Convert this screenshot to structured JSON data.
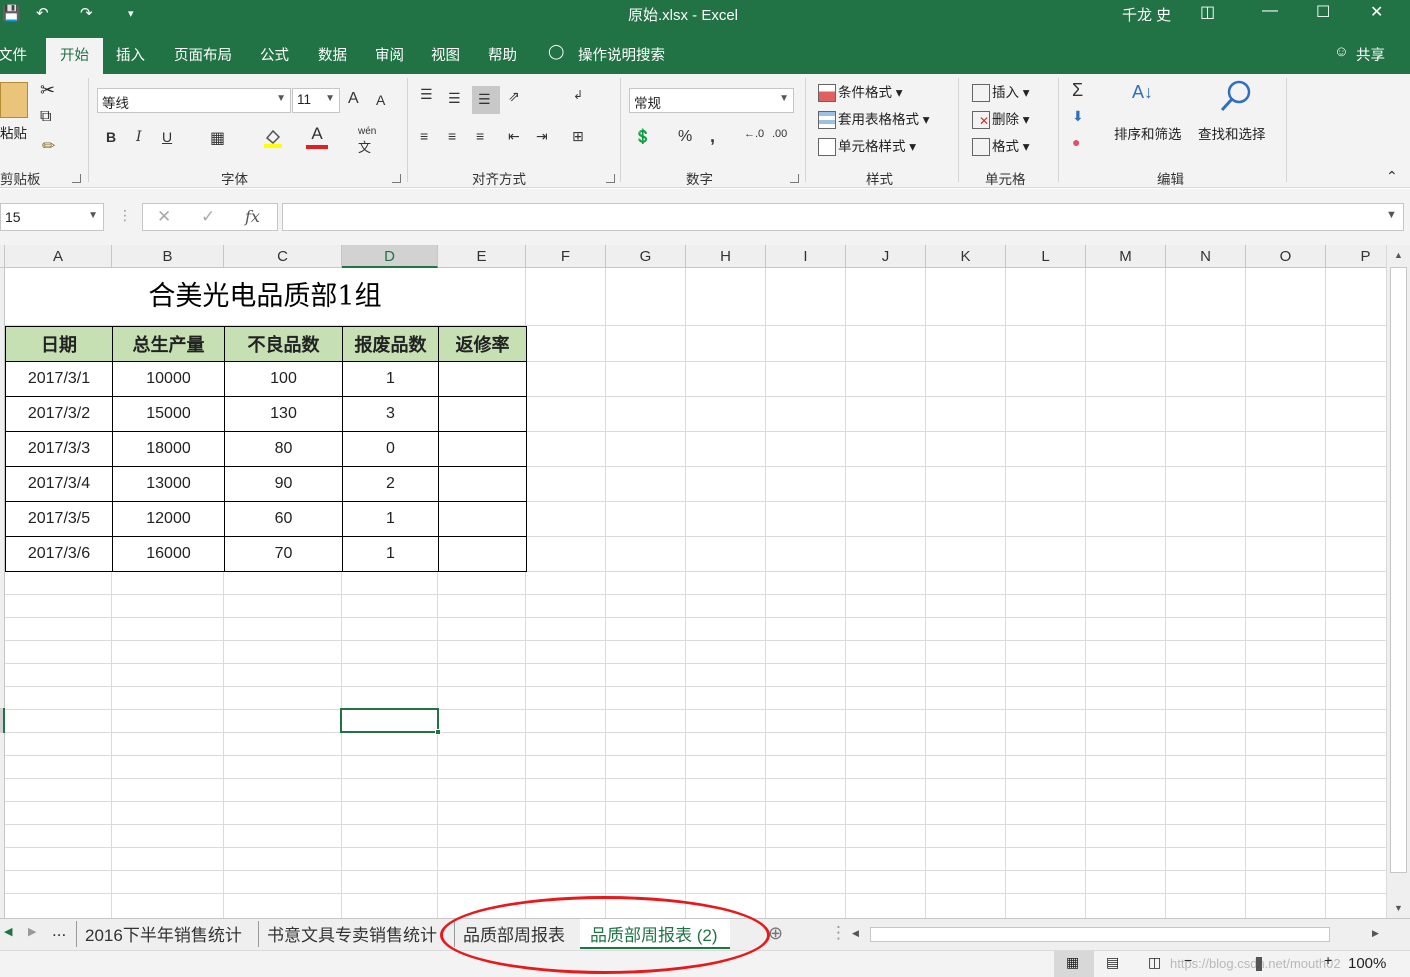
{
  "window": {
    "title": "原始.xlsx  -  Excel",
    "user": "千龙 史"
  },
  "ribbon_tabs": [
    "文件",
    "开始",
    "插入",
    "页面布局",
    "公式",
    "数据",
    "审阅",
    "视图",
    "帮助"
  ],
  "tell_me": "操作说明搜索",
  "share": "共享",
  "ribbon": {
    "clipboard": {
      "paste": "粘贴",
      "label": "剪贴板"
    },
    "font": {
      "name": "等线",
      "size": "11",
      "label": "字体",
      "bold": "B",
      "italic": "I",
      "underline": "U",
      "grow": "A",
      "shrink": "A",
      "phonetic": "wén",
      "phonetic_char": "文",
      "font_color_glyph": "A"
    },
    "alignment": {
      "label": "对齐方式"
    },
    "number": {
      "format": "常规",
      "label": "数字",
      "percent": "%",
      "comma": ","
    },
    "styles": {
      "conditional": "条件格式",
      "table": "套用表格格式",
      "cell": "单元格样式",
      "label": "样式"
    },
    "cells": {
      "insert": "插入",
      "delete": "删除",
      "format": "格式",
      "label": "单元格"
    },
    "editing": {
      "sum": "Σ",
      "sort": "排序和筛选",
      "find": "查找和选择",
      "label": "编辑"
    }
  },
  "formula_bar": {
    "name_box": "15",
    "fx": "fx",
    "formula": ""
  },
  "columns": [
    "A",
    "B",
    "C",
    "D",
    "E",
    "F",
    "G",
    "H",
    "I",
    "J",
    "K",
    "L",
    "M",
    "N",
    "O",
    "P"
  ],
  "sheet": {
    "title": "合美光电品质部1组",
    "headers": [
      "日期",
      "总生产量",
      "不良品数",
      "报废品数",
      "返修率"
    ],
    "rows": [
      [
        "2017/3/1",
        "10000",
        "100",
        "1",
        ""
      ],
      [
        "2017/3/2",
        "15000",
        "130",
        "3",
        ""
      ],
      [
        "2017/3/3",
        "18000",
        "80",
        "0",
        ""
      ],
      [
        "2017/3/4",
        "13000",
        "90",
        "2",
        ""
      ],
      [
        "2017/3/5",
        "12000",
        "60",
        "1",
        ""
      ],
      [
        "2017/3/6",
        "16000",
        "70",
        "1",
        ""
      ]
    ]
  },
  "sheet_tabs": {
    "ellipsis": "...",
    "tabs": [
      "2016下半年销售统计",
      "书意文具专卖销售统计",
      "品质部周报表",
      "品质部周报表 (2)"
    ],
    "active_index": 3
  },
  "status": {
    "zoom": "100%",
    "watermark": "https://blog.csdn.net/mouth02"
  }
}
